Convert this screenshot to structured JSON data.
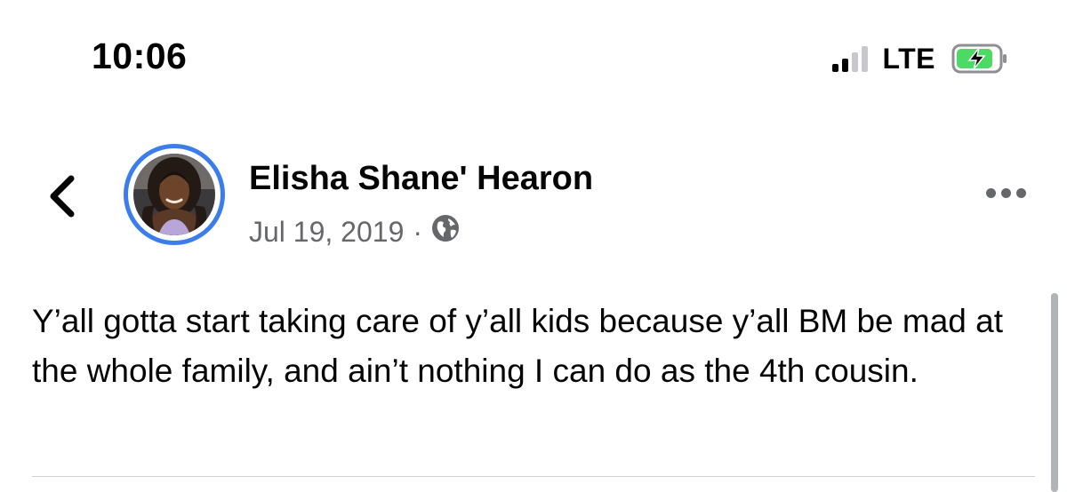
{
  "status_bar": {
    "time": "10:06",
    "network": "LTE",
    "signal_bars_active": 2,
    "signal_bars_total": 4,
    "battery_charging": true,
    "battery_color": "#4cd964"
  },
  "post": {
    "author": "Elisha Shane' Hearon",
    "date": "Jul 19, 2019",
    "separator": "·",
    "audience_icon": "globe-icon",
    "text": "Y’all gotta start taking care of y’all kids because y’all BM be mad at the whole family, and ain’t nothing I can do as the 4th cousin."
  },
  "colors": {
    "avatar_ring": "#3b7ded",
    "secondary_text": "#65676b",
    "primary_text": "#050505"
  }
}
